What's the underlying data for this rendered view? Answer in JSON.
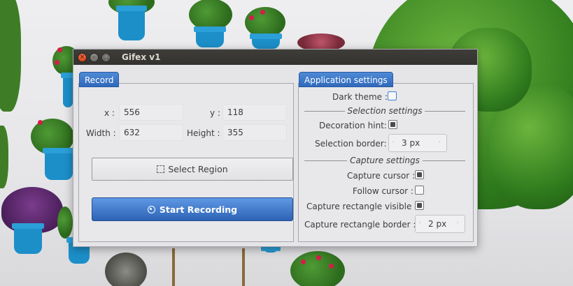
{
  "window": {
    "title": "Gifex v1",
    "controls": {
      "close": "×",
      "minimize": "–",
      "maximize": "□"
    }
  },
  "record": {
    "tab_label": "Record",
    "x_label": "x :",
    "x_value": "556",
    "y_label": "y :",
    "y_value": "118",
    "width_label": "Width :",
    "width_value": "632",
    "height_label": "Height :",
    "height_value": "355",
    "select_region_label": "Select Region",
    "start_recording_label": "Start Recording"
  },
  "settings": {
    "tab_label": "Application settings",
    "dark_theme": {
      "label": "Dark theme :",
      "checked": false
    },
    "selection_section": "Selection settings",
    "decoration_hint": {
      "label": "Decoration hint:",
      "checked": true
    },
    "selection_border": {
      "label": "Selection border:",
      "value": "3 px"
    },
    "capture_section": "Capture settings",
    "capture_cursor": {
      "label": "Capture cursor :",
      "checked": true
    },
    "follow_cursor": {
      "label": "Follow cursor :",
      "checked": false
    },
    "capture_rect_visible": {
      "label": "Capture rectangle visible :",
      "checked": true
    },
    "capture_rect_border": {
      "label": "Capture rectangle border :",
      "value": "2 px"
    }
  },
  "icons": {
    "select_region": "region-select-icon",
    "start_recording": "record-icon",
    "spin_down": "‹",
    "spin_up": "›"
  },
  "colors": {
    "accent": "#2f69bc",
    "titlebar": "#3a3935",
    "close_button": "#dd4814"
  }
}
